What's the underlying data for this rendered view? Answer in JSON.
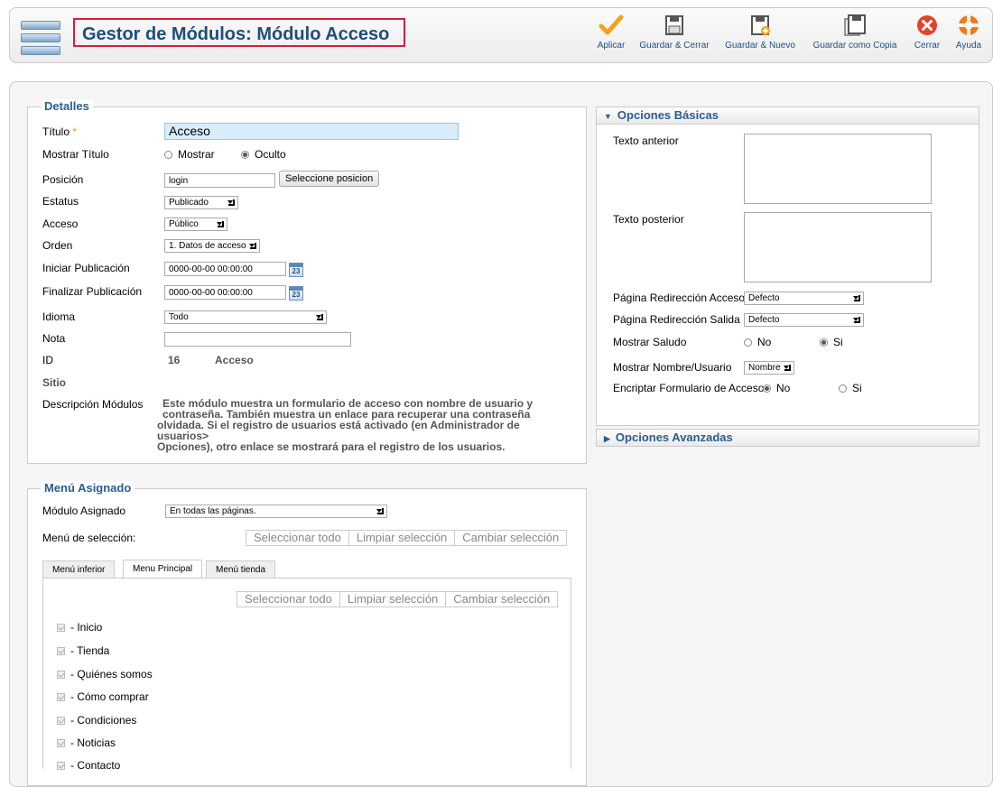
{
  "header": {
    "title": "Gestor de Módulos: Módulo Acceso"
  },
  "toolbar": {
    "apply": "Aplicar",
    "save_close": "Guardar & Cerrar",
    "save_new": "Guardar & Nuevo",
    "save_copy": "Guardar como Copia",
    "close": "Cerrar",
    "help": "Ayuda"
  },
  "details": {
    "legend": "Detalles",
    "title_label": "Título",
    "title_req": "*",
    "title_value": "Acceso",
    "show_title_label": "Mostrar Título",
    "show_opt": "Mostrar",
    "hide_opt": "Oculto",
    "position_label": "Posición",
    "position_value": "login",
    "position_button": "Seleccione posicion",
    "status_label": "Estatus",
    "status_value": "Publicado",
    "access_label": "Acceso",
    "access_value": "Público",
    "order_label": "Orden",
    "order_value": "1. Datos de acceso",
    "start_label": "Iniciar Publicación",
    "start_value": "0000-00-00 00:00:00",
    "end_label": "Finalizar Publicación",
    "end_value": "0000-00-00 00:00:00",
    "cal_num": "23",
    "lang_label": "Idioma",
    "lang_value": "Todo",
    "note_label": "Nota",
    "note_value": "",
    "id_label": "ID",
    "id_value": "16",
    "id_name": "Acceso",
    "site": "Sitio",
    "desc_label": "Descripción Módulos",
    "desc_line1": "Este módulo muestra un formulario de acceso con nombre de usuario y",
    "desc_line2": "contraseña. También muestra un enlace para recuperar una contraseña",
    "desc_line3": "olvidada. Si el registro de usuarios está activado (en Administrador de usuarios>",
    "desc_line4": "Opciones), otro enlace se mostrará para el registro de los usuarios."
  },
  "basic": {
    "header": "Opciones Básicas",
    "pretext_label": "Texto anterior",
    "posttext_label": "Texto posterior",
    "login_redirect_label": "Página Redirección Acceso",
    "login_redirect_value": "Defecto",
    "logout_redirect_label": "Página Redirección Salida",
    "logout_redirect_value": "Defecto",
    "greeting_label": "Mostrar Saludo",
    "no": "No",
    "yes": "Si",
    "name_label": "Mostrar Nombre/Usuario",
    "name_value": "Nombre",
    "encrypt_label": "Encriptar Formulario de Acceso"
  },
  "advanced": {
    "header": "Opciones Avanzadas"
  },
  "menu": {
    "legend": "Menú Asignado",
    "assigned_label": "Módulo Asignado",
    "assigned_value": "En todas las páginas.",
    "selection_label": "Menú de selección:",
    "select_all": "Seleccionar todo",
    "clear_selection": "Limpiar selección",
    "toggle_selection": "Cambiar selección",
    "tabs": [
      "Menú inferior",
      "Menu Principal",
      "Menú tienda"
    ],
    "items": [
      "- Inicio",
      "- Tienda",
      "- Quiénes somos",
      "- Cómo comprar",
      "- Condiciones",
      "- Noticias",
      "- Contacto"
    ]
  }
}
